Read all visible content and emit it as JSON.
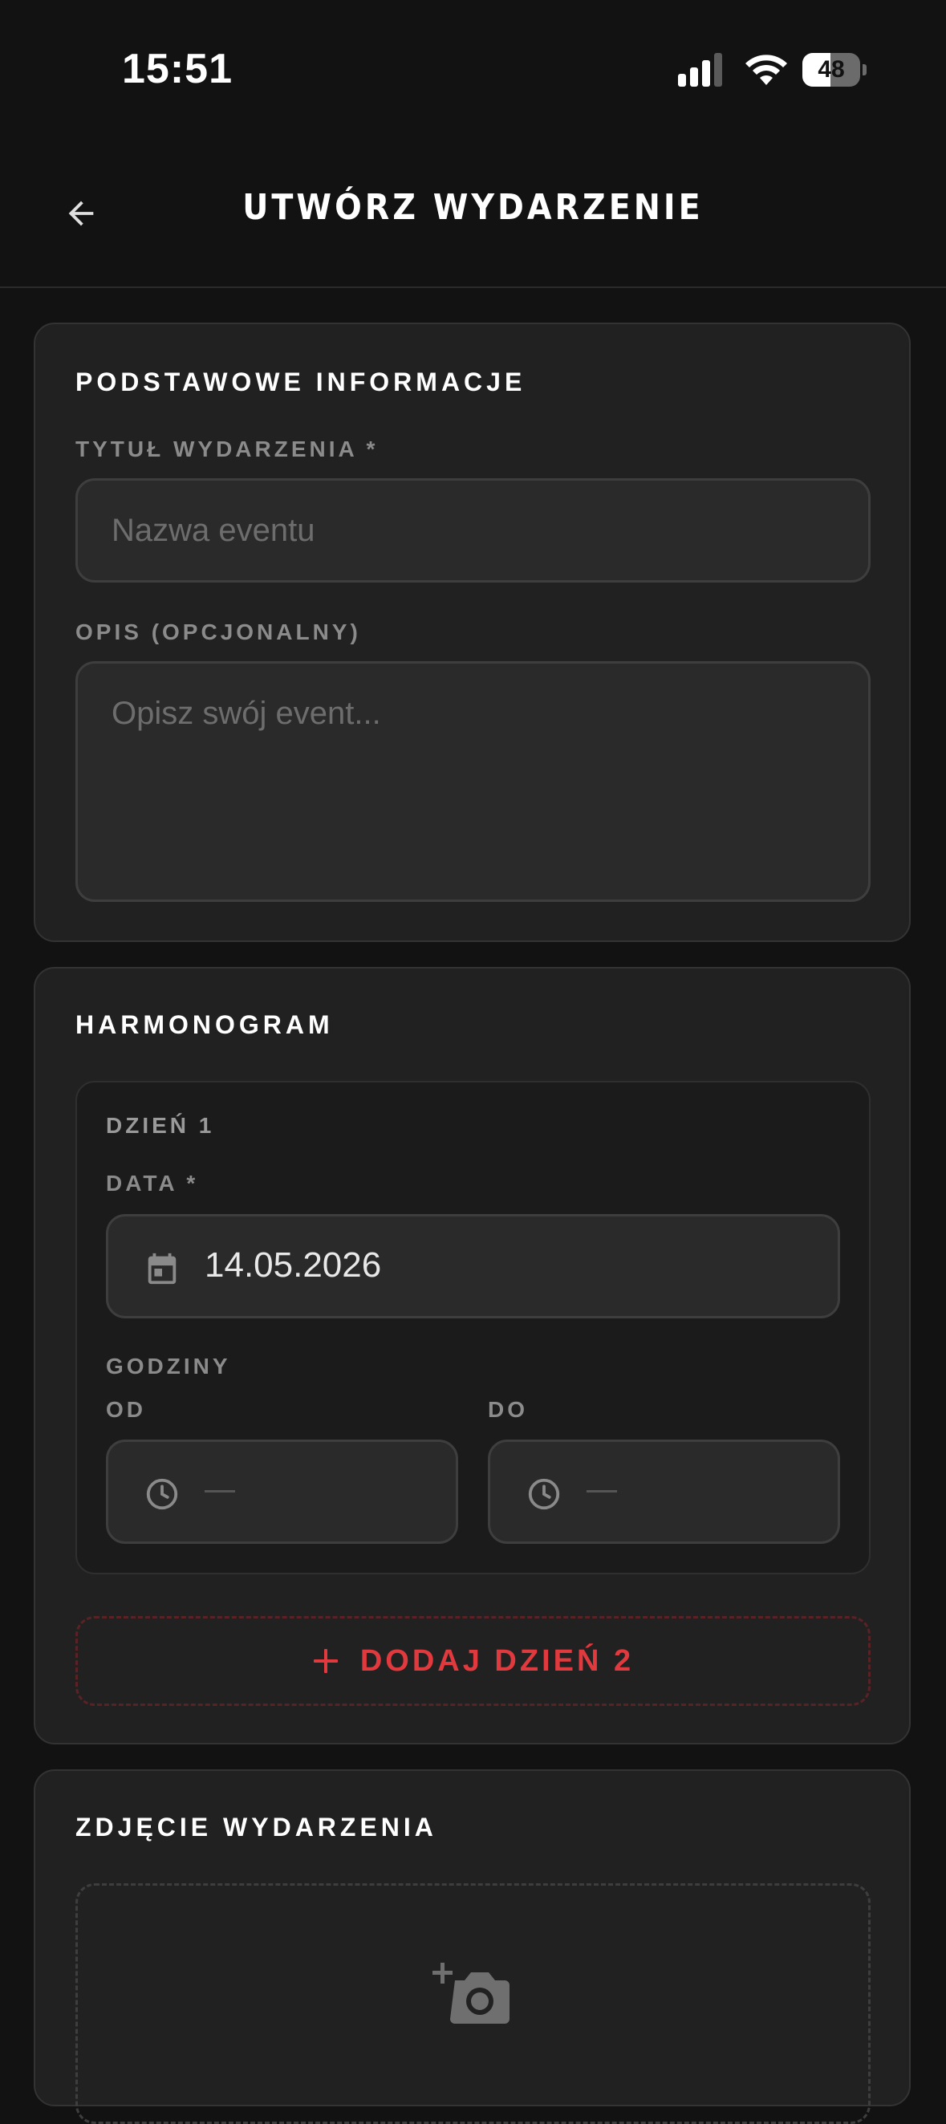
{
  "status_bar": {
    "time": "15:51",
    "battery_percent": "48",
    "battery_level": 0.48
  },
  "header": {
    "title": "UTWÓRZ WYDARZENIE",
    "back_icon": "arrow-left-icon"
  },
  "basic_info": {
    "title": "PODSTAWOWE INFORMACJE",
    "event_title_label": "TYTUŁ WYDARZENIA *",
    "event_title_placeholder": "Nazwa eventu",
    "description_label": "OPIS (OPCJONALNY)",
    "description_placeholder": "Opisz swój event..."
  },
  "schedule": {
    "title": "HARMONOGRAM",
    "day": {
      "title": "DZIEŃ 1",
      "date_label": "DATA *",
      "date_value": "14.05.2026",
      "hours_label": "GODZINY",
      "from_label": "OD",
      "to_label": "DO",
      "from_value": "",
      "to_value": ""
    },
    "add_day_label": "DODAJ DZIEŃ 2"
  },
  "photo": {
    "title": "ZDJĘCIE WYDARZENIA",
    "icon": "add-photo-icon"
  },
  "colors": {
    "background": "#121212",
    "card": "#212121",
    "accent": "#e0393e",
    "muted_text": "#8b8b8b"
  }
}
